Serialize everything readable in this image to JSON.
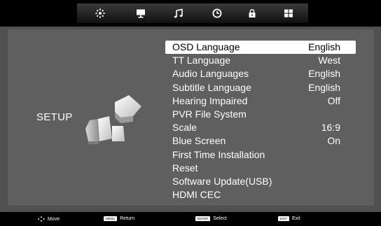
{
  "tabs": [
    {
      "icon": "picture-icon",
      "active": false
    },
    {
      "icon": "tv-screen-icon",
      "active": false
    },
    {
      "icon": "music-note-icon",
      "active": false
    },
    {
      "icon": "clock-icon",
      "active": false
    },
    {
      "icon": "lock-icon",
      "active": false
    },
    {
      "icon": "setup-grid-icon",
      "active": true
    }
  ],
  "section": {
    "title": "SETUP",
    "icon": "setup-blocks-icon"
  },
  "menu": {
    "items": [
      {
        "label": "OSD Language",
        "value": "English",
        "selected": true
      },
      {
        "label": "TT  Language",
        "value": "West"
      },
      {
        "label": "Audio Languages",
        "value": "English"
      },
      {
        "label": "Subtitle Language",
        "value": "English"
      },
      {
        "label": "Hearing Impaired",
        "value": "Off"
      },
      {
        "label": "PVR File System",
        "value": ""
      },
      {
        "label": "Scale",
        "value": "16:9"
      },
      {
        "label": "Blue Screen",
        "value": "On"
      },
      {
        "label": "First Time Installation",
        "value": ""
      },
      {
        "label": "Reset",
        "value": ""
      },
      {
        "label": "Software Update(USB)",
        "value": ""
      },
      {
        "label": "HDMI CEC",
        "value": ""
      }
    ]
  },
  "footer": {
    "move": {
      "icon": "four-way-arrow-icon",
      "text": "Move"
    },
    "return": {
      "key": "MENU",
      "text": "Return"
    },
    "select": {
      "key": "ENTER",
      "text": "Select"
    },
    "exit": {
      "key": "EXIT",
      "text": "Exit"
    }
  },
  "colors": {
    "background": "#505050",
    "panel": "#5f5f5f",
    "bar": "#000000",
    "highlight": "#ffffff",
    "text": "#ffffff"
  }
}
